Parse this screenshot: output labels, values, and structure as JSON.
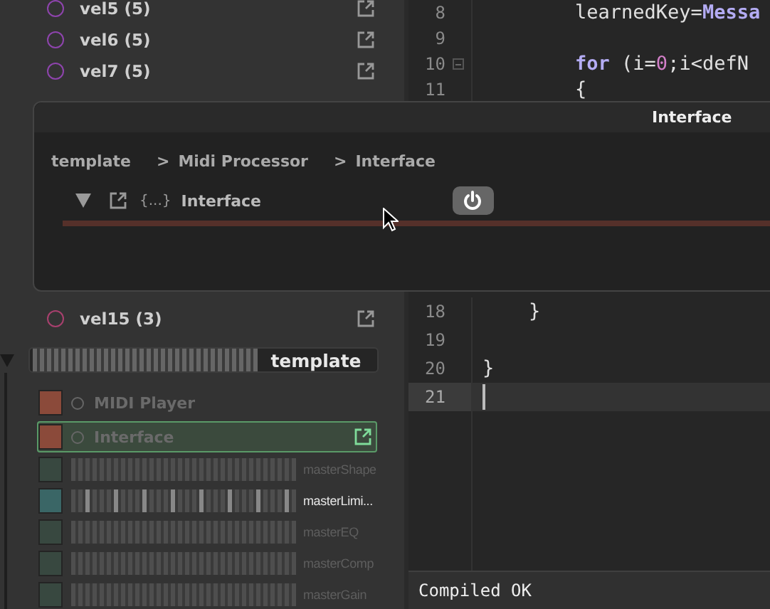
{
  "voices": [
    {
      "label": "vel5 (5)",
      "color": "#8e44ad"
    },
    {
      "label": "vel6 (5)",
      "color": "#8e44ad"
    },
    {
      "label": "vel7 (5)",
      "color": "#8e44ad"
    },
    {
      "label": "vel15 (3)",
      "color": "#a8406e"
    }
  ],
  "container": {
    "name": "template"
  },
  "modules": [
    {
      "kind": "module",
      "name": "MIDI Player",
      "color": "#8b4a3a",
      "selected": false
    },
    {
      "kind": "module",
      "name": "Interface",
      "color": "#8b4a3a",
      "selected": true
    },
    {
      "kind": "effect",
      "name": "masterShape",
      "color": "#384840",
      "active": false
    },
    {
      "kind": "effect",
      "name": "masterLimi...",
      "color": "#3a6666",
      "active": true
    },
    {
      "kind": "effect",
      "name": "masterEQ",
      "color": "#384840",
      "active": false
    },
    {
      "kind": "effect",
      "name": "masterComp",
      "color": "#384840",
      "active": false
    },
    {
      "kind": "effect",
      "name": "masterGain",
      "color": "#384840",
      "active": false
    }
  ],
  "editor": {
    "lines_top": [
      {
        "number": "8",
        "fold_marker": false,
        "current": false,
        "tokens": [
          {
            "kind": "plain",
            "text": "        learnedKey="
          },
          {
            "kind": "keyword",
            "text": "Messa"
          }
        ]
      },
      {
        "number": "9",
        "fold_marker": false,
        "current": false
      },
      {
        "number": "10",
        "fold_marker": true,
        "current": false,
        "tokens": [
          {
            "kind": "keyword",
            "text": "        for"
          },
          {
            "kind": "plain",
            "text": " (i="
          },
          {
            "kind": "number",
            "text": "0"
          },
          {
            "kind": "plain",
            "text": ";i<defN"
          }
        ]
      },
      {
        "number": "11",
        "fold_marker": false,
        "current": false,
        "tokens": [
          {
            "kind": "plain",
            "text": "        {"
          }
        ]
      }
    ],
    "lines_bottom": [
      {
        "number": "18",
        "fold_marker": false,
        "current": false,
        "tokens": [
          {
            "kind": "plain",
            "text": "    }"
          }
        ]
      },
      {
        "number": "19",
        "fold_marker": false,
        "current": false
      },
      {
        "number": "20",
        "fold_marker": false,
        "current": false,
        "tokens": [
          {
            "kind": "plain",
            "text": "}"
          }
        ]
      },
      {
        "number": "21",
        "fold_marker": false,
        "current": true
      }
    ],
    "status": "Compiled OK"
  },
  "popup": {
    "title": "Interface",
    "breadcrumb": [
      {
        "label": "template"
      },
      {
        "separator": ">",
        "label": "Midi Processor"
      },
      {
        "separator": ">",
        "label": "Interface"
      }
    ],
    "header": {
      "braces": "{...}",
      "name": "Interface",
      "power_on": true
    }
  }
}
